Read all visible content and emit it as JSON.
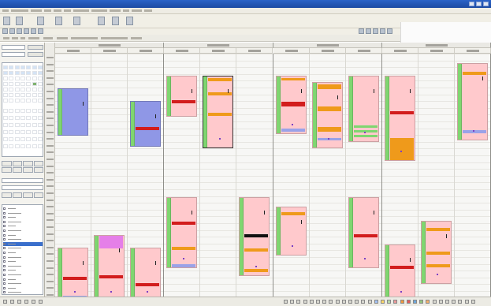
{
  "window": {
    "title": ""
  },
  "colors": {
    "titlebar": "#1c4aa2",
    "appointment_pink": "#ffc9cc",
    "appointment_blue": "#8f97e6",
    "appointment_magenta": "#e57fe8",
    "stripe_red": "#d21d1d",
    "stripe_orange": "#ef9a1b",
    "stripe_black": "#111111",
    "side_green": "#7fd670",
    "selection_blue": "#3a6fcc"
  },
  "icons": [
    "minimize-icon",
    "maximize-icon",
    "close-icon",
    "toolbar-icon",
    "calendar-icon",
    "checkbox-icon",
    "status-icon"
  ],
  "scheduler": {
    "group_count": 4,
    "column_count": 12,
    "appointment_colors": [
      "pink",
      "blue",
      "magenta"
    ]
  }
}
